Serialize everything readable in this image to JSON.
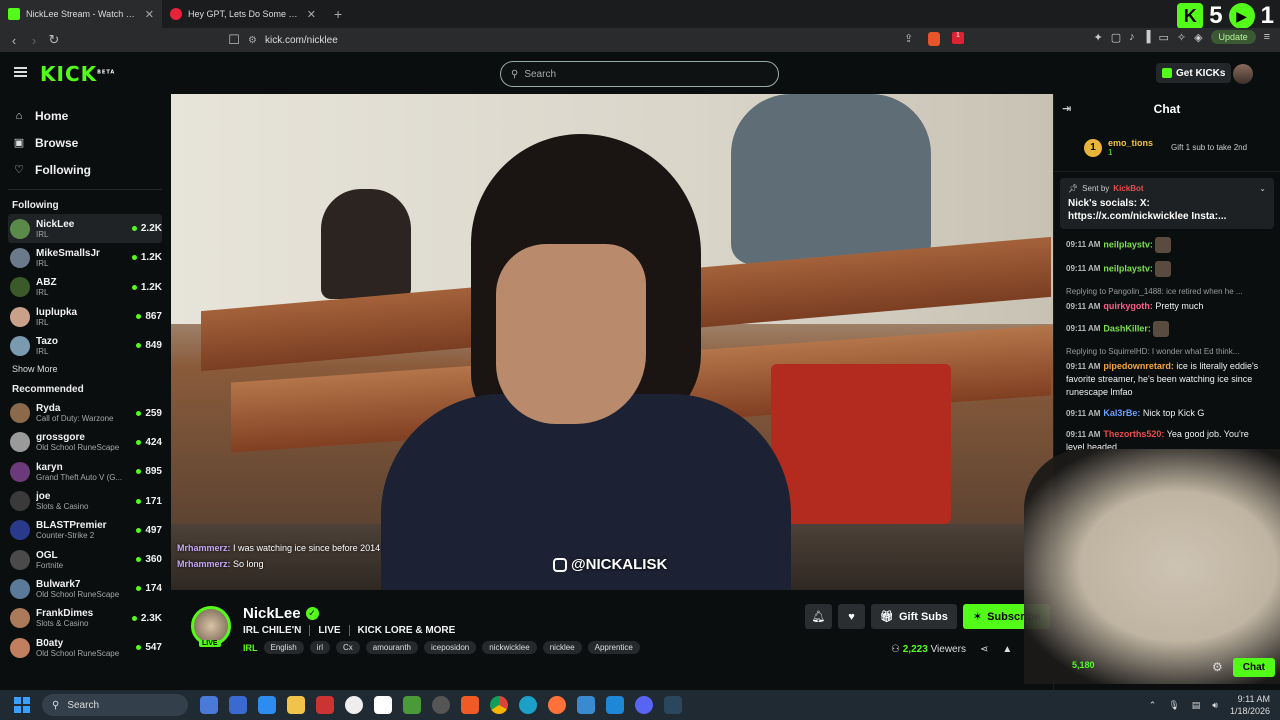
{
  "browser": {
    "tabs": [
      {
        "title": "NickLee Stream - Watch Live",
        "active": true,
        "favicon_color": "#53fc18"
      },
      {
        "title": "Hey GPT, Lets Do Some Riddles - Yo",
        "active": false,
        "favicon_color": "#e8223a"
      }
    ],
    "url": "kick.com/nicklee",
    "update_label": "Update",
    "ext_badge": "1"
  },
  "overlay_score": {
    "left": "5",
    "right": "1"
  },
  "header": {
    "logo": "KICK",
    "logo_beta": "BETA",
    "search_placeholder": "Search",
    "get_kicks_label": "Get KICKs"
  },
  "sidebar": {
    "nav": [
      {
        "label": "Home",
        "icon": "home-icon",
        "glyph": "⌂"
      },
      {
        "label": "Browse",
        "icon": "browse-icon",
        "glyph": "▣"
      },
      {
        "label": "Following",
        "icon": "heart-icon",
        "glyph": "♡"
      }
    ],
    "following_title": "Following",
    "following": [
      {
        "name": "NickLee",
        "category": "IRL",
        "viewers": "2.2K",
        "color": "#5a8a4a"
      },
      {
        "name": "MikeSmallsJr",
        "category": "IRL",
        "viewers": "1.2K",
        "color": "#6a7a8a"
      },
      {
        "name": "ABZ",
        "category": "IRL",
        "viewers": "1.2K",
        "color": "#3a5a2a"
      },
      {
        "name": "luplupka",
        "category": "IRL",
        "viewers": "867",
        "color": "#c9a08a"
      },
      {
        "name": "Tazo",
        "category": "IRL",
        "viewers": "849",
        "color": "#7a9ab0"
      }
    ],
    "show_more": "Show More",
    "recommended_title": "Recommended",
    "recommended": [
      {
        "name": "Ryda",
        "category": "Call of Duty: Warzone",
        "viewers": "259",
        "color": "#8a6a4a"
      },
      {
        "name": "grossgore",
        "category": "Old School RuneScape",
        "viewers": "424",
        "color": "#9a9a9a"
      },
      {
        "name": "karyn",
        "category": "Grand Theft Auto V (G...",
        "viewers": "895",
        "color": "#6a3a7a"
      },
      {
        "name": "joe",
        "category": "Slots & Casino",
        "viewers": "171",
        "color": "#3a3a3a"
      },
      {
        "name": "BLASTPremier",
        "category": "Counter-Strike 2",
        "viewers": "497",
        "color": "#2a3a8a"
      },
      {
        "name": "OGL",
        "category": "Fortnite",
        "viewers": "360",
        "color": "#4a4a4a"
      },
      {
        "name": "Bulwark7",
        "category": "Old School RuneScape",
        "viewers": "174",
        "color": "#5a7a9a"
      },
      {
        "name": "FrankDimes",
        "category": "Slots & Casino",
        "viewers": "2.3K",
        "color": "#aa7a5a"
      },
      {
        "name": "B0aty",
        "category": "Old School RuneScape",
        "viewers": "547",
        "color": "#c08060"
      }
    ]
  },
  "video": {
    "watermark": "@NICKALISK",
    "overlay_chat": [
      {
        "user": "Mrhammerz:",
        "text": "I was watching ice since before 2014"
      },
      {
        "user": "Mrhammerz:",
        "text": "So long"
      }
    ]
  },
  "stream": {
    "channel": "NickLee",
    "live_badge": "LIVE",
    "title_parts": [
      "IRL CHILE'N",
      "LIVE",
      "KICK LORE & MORE"
    ],
    "category": "IRL",
    "tags": [
      "English",
      "irl",
      "Cx",
      "amouranth",
      "iceposidon",
      "nickwicklee",
      "nicklee",
      "Apprentice"
    ],
    "gift_label": "Gift Subs",
    "subscribe_label": "Subscribe",
    "viewers": "2,223",
    "viewers_suffix": "Viewers"
  },
  "chat": {
    "title": "Chat",
    "gifter": {
      "rank": "1",
      "name": "emo_tions",
      "count": "1",
      "cta": "Gift 1 sub to take 2nd"
    },
    "pinned": {
      "sent_by": "Sent by",
      "bot": "KickBot",
      "message": "Nick's socials: X: https://x.com/nickwicklee Insta:..."
    },
    "messages": [
      {
        "time": "09:11 AM",
        "user": "neilplaystv:",
        "color": "#7be04a",
        "text": "",
        "reply": "",
        "emote": true
      },
      {
        "time": "09:11 AM",
        "user": "neilplaystv:",
        "color": "#7be04a",
        "text": "",
        "reply": "",
        "emote": true
      },
      {
        "time": "09:11 AM",
        "user": "quirkygoth:",
        "color": "#ff5c8a",
        "text": "Pretty much",
        "reply": "Replying to Pangolin_1488: ice retired when he ...",
        "emote": false
      },
      {
        "time": "09:11 AM",
        "user": "DashKiller:",
        "color": "#7be04a",
        "text": "",
        "reply": "",
        "emote": true
      },
      {
        "time": "09:11 AM",
        "user": "pipedownretard:",
        "color": "#f2a53a",
        "text": "ice is literally eddie's favorite streamer, he's been watching ice since runescape lmfao",
        "reply": "Replying to SquirrelHD: I wonder what Ed think...",
        "emote": false
      },
      {
        "time": "09:11 AM",
        "user": "Kal3rBe:",
        "color": "#6aa0ff",
        "text": "Nick top Kick G",
        "reply": "",
        "emote": false
      },
      {
        "time": "09:11 AM",
        "user": "Thezorths520:",
        "color": "#e84c4c",
        "text": "Yea good job. You're level headed",
        "reply": "",
        "emote": false
      }
    ],
    "kicks_count": "5,180",
    "chat_button": "Chat"
  },
  "taskbar": {
    "search": "Search",
    "time": "9:11 AM",
    "date": "1/18/2026"
  }
}
